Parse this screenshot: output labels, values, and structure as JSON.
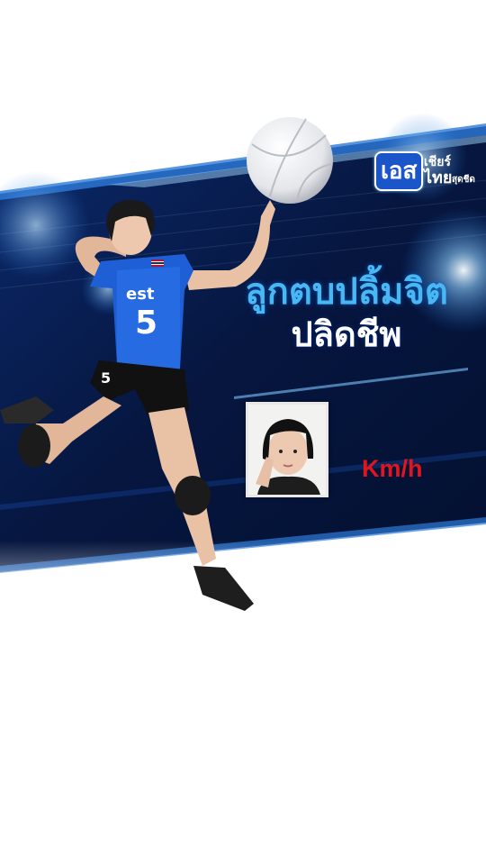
{
  "headline": {
    "line1": "ลูกตบปลิ้มจิต",
    "line2": "ปลิดชีพ"
  },
  "speed": {
    "unit": "Km/h"
  },
  "logo": {
    "brand": "เอส",
    "tag_line1": "เชียร์",
    "tag_line2": "ไทย",
    "tag_line3": "สุดชีด"
  },
  "jersey": {
    "number": "5",
    "sponsor": "est"
  },
  "colors": {
    "headline_blue": "#49b7f2",
    "unit_red": "#e0161f",
    "banner_navy": "#071a4a",
    "jersey_blue": "#1f5fd6"
  },
  "icons": {
    "volleyball": "volleyball-icon",
    "thai_flag": "thai-flag-icon"
  }
}
